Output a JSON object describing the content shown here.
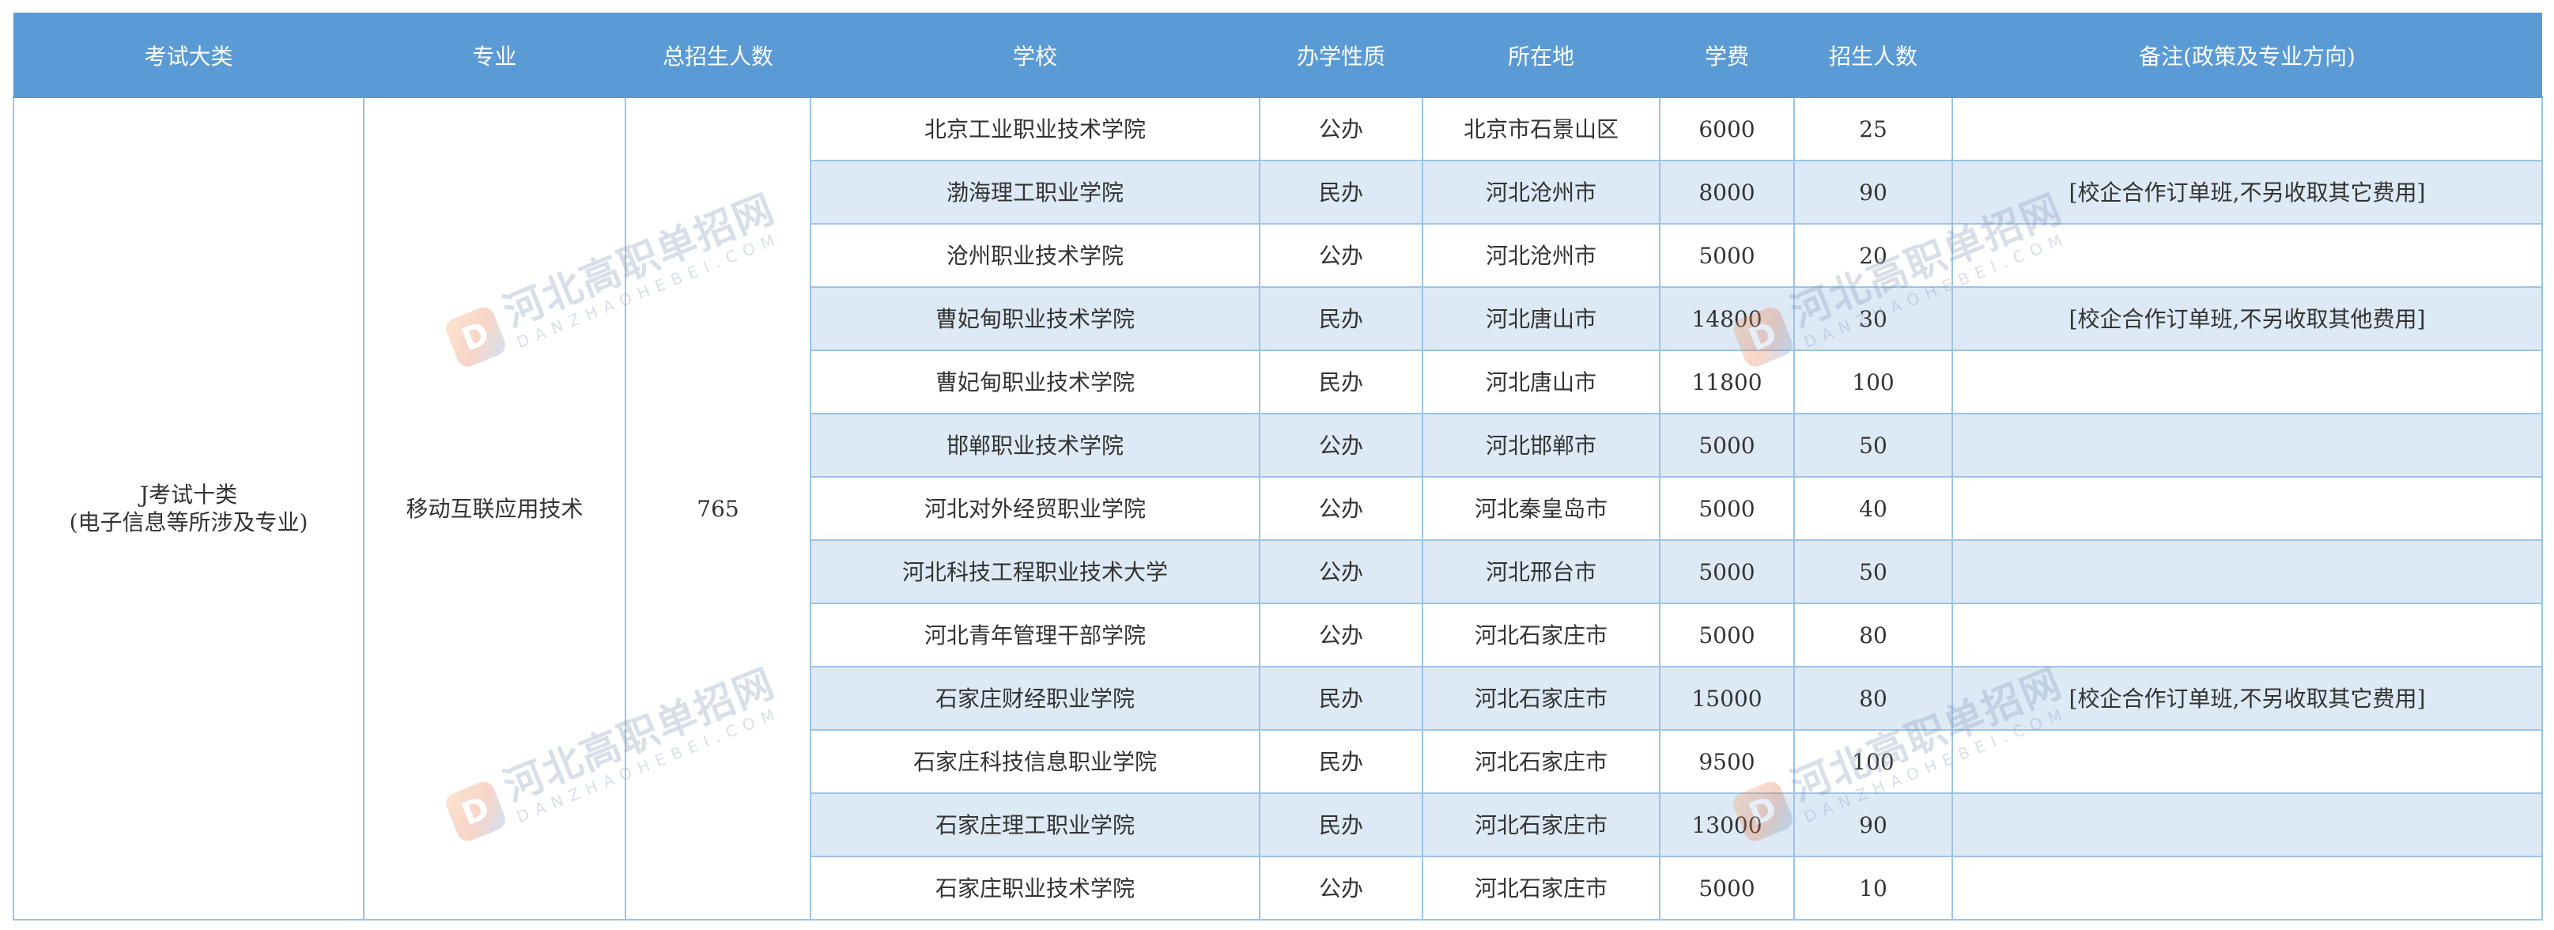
{
  "headers": [
    "考试大类",
    "专业",
    "总招生人数",
    "学校",
    "办学性质",
    "所在地",
    "学费",
    "招生人数",
    "备注(政策及专业方向)"
  ],
  "category": [
    "J考试十类",
    "(电子信息等所涉及专业)"
  ],
  "major": "移动互联应用技术",
  "total": "765",
  "rows": [
    {
      "school": "北京工业职业技术学院",
      "nature": "公办",
      "location": "北京市石景山区",
      "fee": "6000",
      "quota": "25",
      "note": ""
    },
    {
      "school": "渤海理工职业学院",
      "nature": "民办",
      "location": "河北沧州市",
      "fee": "8000",
      "quota": "90",
      "note": "[校企合作订单班,不另收取其它费用]"
    },
    {
      "school": "沧州职业技术学院",
      "nature": "公办",
      "location": "河北沧州市",
      "fee": "5000",
      "quota": "20",
      "note": ""
    },
    {
      "school": "曹妃甸职业技术学院",
      "nature": "民办",
      "location": "河北唐山市",
      "fee": "14800",
      "quota": "30",
      "note": "[校企合作订单班,不另收取其他费用]"
    },
    {
      "school": "曹妃甸职业技术学院",
      "nature": "民办",
      "location": "河北唐山市",
      "fee": "11800",
      "quota": "100",
      "note": ""
    },
    {
      "school": "邯郸职业技术学院",
      "nature": "公办",
      "location": "河北邯郸市",
      "fee": "5000",
      "quota": "50",
      "note": ""
    },
    {
      "school": "河北对外经贸职业学院",
      "nature": "公办",
      "location": "河北秦皇岛市",
      "fee": "5000",
      "quota": "40",
      "note": ""
    },
    {
      "school": "河北科技工程职业技术大学",
      "nature": "公办",
      "location": "河北邢台市",
      "fee": "5000",
      "quota": "50",
      "note": ""
    },
    {
      "school": "河北青年管理干部学院",
      "nature": "公办",
      "location": "河北石家庄市",
      "fee": "5000",
      "quota": "80",
      "note": ""
    },
    {
      "school": "石家庄财经职业学院",
      "nature": "民办",
      "location": "河北石家庄市",
      "fee": "15000",
      "quota": "80",
      "note": "[校企合作订单班,不另收取其它费用]"
    },
    {
      "school": "石家庄科技信息职业学院",
      "nature": "民办",
      "location": "河北石家庄市",
      "fee": "9500",
      "quota": "100",
      "note": ""
    },
    {
      "school": "石家庄理工职业学院",
      "nature": "民办",
      "location": "河北石家庄市",
      "fee": "13000",
      "quota": "90",
      "note": ""
    },
    {
      "school": "石家庄职业技术学院",
      "nature": "公办",
      "location": "河北石家庄市",
      "fee": "5000",
      "quota": "10",
      "note": ""
    }
  ],
  "watermark": {
    "logo": "D",
    "cn": "河北高职单招网",
    "en": "DANZHAOHEBEI.COM"
  },
  "colors": {
    "header_bg": "#5b9bd5",
    "header_text": "#ffffff",
    "alt_row_bg": "#ddeaf6",
    "grid": "#9cc3e5"
  }
}
